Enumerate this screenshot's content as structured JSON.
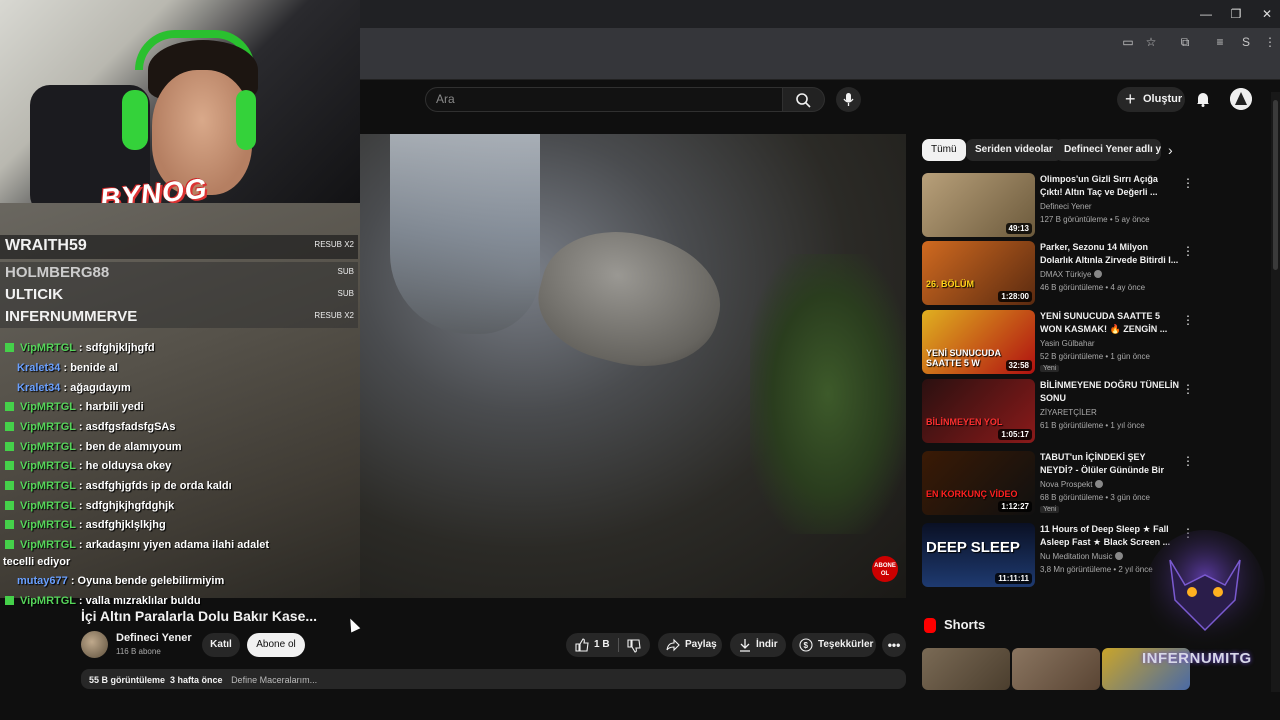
{
  "search": {
    "placeholder": "Ara"
  },
  "header": {
    "create_label": "Oluştur"
  },
  "stream": {
    "overlay_brand": "BYNOG",
    "sub_alerts": [
      {
        "name": "WRAITH59",
        "tag": "RESUB X2"
      },
      {
        "name": "HOLMBERG88",
        "tag": "SUB"
      },
      {
        "name": "ULTICIK",
        "tag": "SUB"
      },
      {
        "name": "INFERNUMMERVE",
        "tag": "RESUB X2"
      }
    ],
    "chat": [
      {
        "user": "VipMRTGL",
        "color": "green",
        "text": "sdfghjkljhgfd"
      },
      {
        "user": "Kralet34",
        "color": "blue",
        "text": "benide al"
      },
      {
        "user": "Kralet34",
        "color": "blue",
        "text": "ağagıdayım"
      },
      {
        "user": "VipMRTGL",
        "color": "green",
        "text": "harbili yedi"
      },
      {
        "user": "VipMRTGL",
        "color": "green",
        "text": "asdfgsfadsfgSAs"
      },
      {
        "user": "VipMRTGL",
        "color": "green",
        "text": "ben de alamıyoum"
      },
      {
        "user": "VipMRTGL",
        "color": "green",
        "text": "he olduysa okey"
      },
      {
        "user": "VipMRTGL",
        "color": "green",
        "text": "asdfghjgfds ip de orda kaldı"
      },
      {
        "user": "VipMRTGL",
        "color": "green",
        "text": "sdfghjkjhgfdghjk"
      },
      {
        "user": "VipMRTGL",
        "color": "green",
        "text": "asdfghjklşlkjhg"
      },
      {
        "user": "VipMRTGL",
        "color": "green",
        "text": "arkadaşını yiyen adama ilahi adalet"
      },
      {
        "user": "",
        "color": "none",
        "text": "tecelli ediyor"
      },
      {
        "user": "mutay677",
        "color": "blue",
        "text": "Oyuna bende gelebilirmiyim"
      },
      {
        "user": "VipMRTGL",
        "color": "green",
        "text": "valla mızraklılar buldu"
      }
    ],
    "logo_text": "INFERNUMITG"
  },
  "video": {
    "title": "İçi Altın Paralarla Dolu Bakır Kase...",
    "channel": "Defineci Yener",
    "subscribers": "116 B abone",
    "join_label": "Katıl",
    "subscribe_label": "Abone ol",
    "likes": "1 B",
    "share_label": "Paylaş",
    "download_label": "İndir",
    "thanks_label": "Teşekkürler",
    "views": "55 B görüntüleme",
    "age": "3 hafta önce",
    "description": "Define Maceralarım...",
    "badge_text": "ABONE OL"
  },
  "sidebar": {
    "chips": [
      "Tümü",
      "Seriden videolar",
      "Defineci Yener adlı yü"
    ],
    "recommendations": [
      {
        "title": "Olimpos'un Gizli Sırrı Açığa Çıktı! Altın Taç ve Değerli ...",
        "channel": "Defineci Yener",
        "meta": "127 B görüntüleme • 5 ay önce",
        "duration": "49:13",
        "new": "",
        "verified": false
      },
      {
        "title": "Parker, Sezonu 14 Milyon Dolarlık Altınla Zirvede Bitirdi I...",
        "channel": "DMAX Türkiye",
        "meta": "46 B görüntüleme • 4 ay önce",
        "duration": "1:28:00",
        "new": "",
        "verified": true
      },
      {
        "title": "YENİ SUNUCUDA SAATTE 5 WON KASMAK! 🔥 ZENGİN ...",
        "channel": "Yasin Gülbahar",
        "meta": "52 B görüntüleme • 1 gün önce",
        "duration": "32:58",
        "new": "Yeni",
        "verified": false
      },
      {
        "title": "BİLİNMEYENE DOĞRU TÜNELİN SONU",
        "channel": "ZİYARETÇİLER",
        "meta": "61 B görüntüleme • 1 yıl önce",
        "duration": "1:05:17",
        "new": "",
        "verified": false
      },
      {
        "title": "TABUT'un İÇİNDEKİ ŞEY NEYDİ? - Ölüler Gününde Bir Gece | ...",
        "channel": "Nova Prospekt",
        "meta": "68 B görüntüleme • 3 gün önce",
        "duration": "1:12:27",
        "new": "Yeni",
        "verified": true
      },
      {
        "title": "11 Hours of Deep Sleep ★ Fall Asleep Fast ★ Black Screen ...",
        "channel": "Nu Meditation Music",
        "meta": "3,8 Mn görüntüleme • 2 yıl önce",
        "duration": "11:11:11",
        "new": "",
        "verified": true
      }
    ],
    "thumb_texts": [
      "",
      "26. BÖLÜM",
      "YENİ SUNUCUDA SAATTE 5 W",
      "BİLİNMEYEN YOL",
      "EN KORKUNÇ VİDEO",
      "DEEP SLEEP"
    ],
    "shorts_title": "Shorts"
  }
}
